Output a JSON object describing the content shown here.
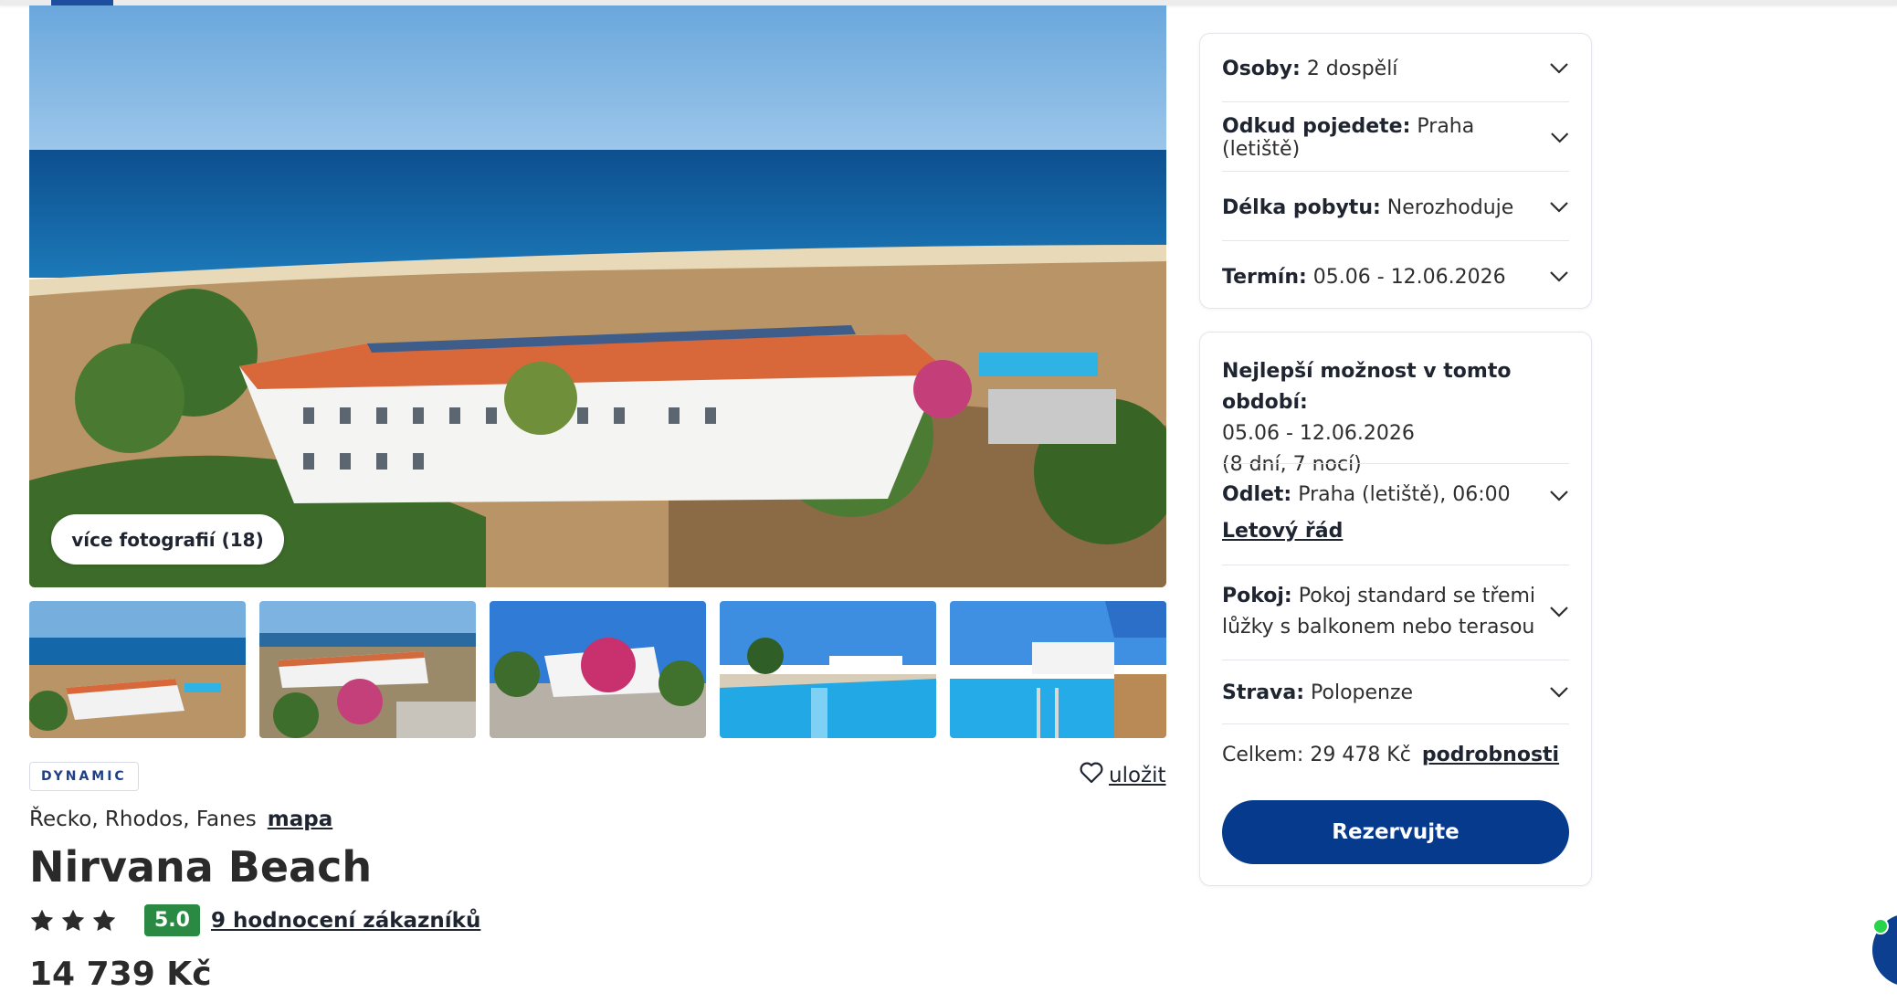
{
  "gallery": {
    "more_photos_label": "více fotografií (18)"
  },
  "hotel": {
    "tag": "DYNAMIC",
    "save_label": "uložit",
    "location": "Řecko, Rhodos, Fanes",
    "map_label": "mapa",
    "name": "Nirvana Beach",
    "stars": 3,
    "rating": "5.0",
    "reviews_label": "9 hodnocení zákazníků",
    "price": "14 739 Kč"
  },
  "search": {
    "persons_label": "Osoby:",
    "persons_value": "2 dospělí",
    "from_label": "Odkud pojedete:",
    "from_value": "Praha (letiště)",
    "length_label": "Délka pobytu:",
    "length_value": "Nerozhoduje",
    "date_label": "Termín:",
    "date_value": "05.06 - 12.06.2026"
  },
  "offer": {
    "best_title": "Nejlepší možnost v tomto období:",
    "best_dates": "05.06 - 12.06.2026",
    "best_duration": "(8 dní, 7 nocí)",
    "departure_label": "Odlet:",
    "departure_value": "Praha (letiště), 06:00",
    "flight_schedule_label": "Letový řád",
    "room_label": "Pokoj:",
    "room_value_line1": "Pokoj standard se třemi",
    "room_value_line2": "lůžky s balkonem nebo terasou",
    "board_label": "Strava:",
    "board_value": "Polopenze",
    "total_label": "Celkem: 29 478 Kč",
    "details_label": "podrobnosti",
    "book_label": "Rezervujte"
  },
  "colors": {
    "primary": "#063a8c",
    "rating_green": "#2a8a43",
    "tag_blue": "#1f3f86"
  }
}
